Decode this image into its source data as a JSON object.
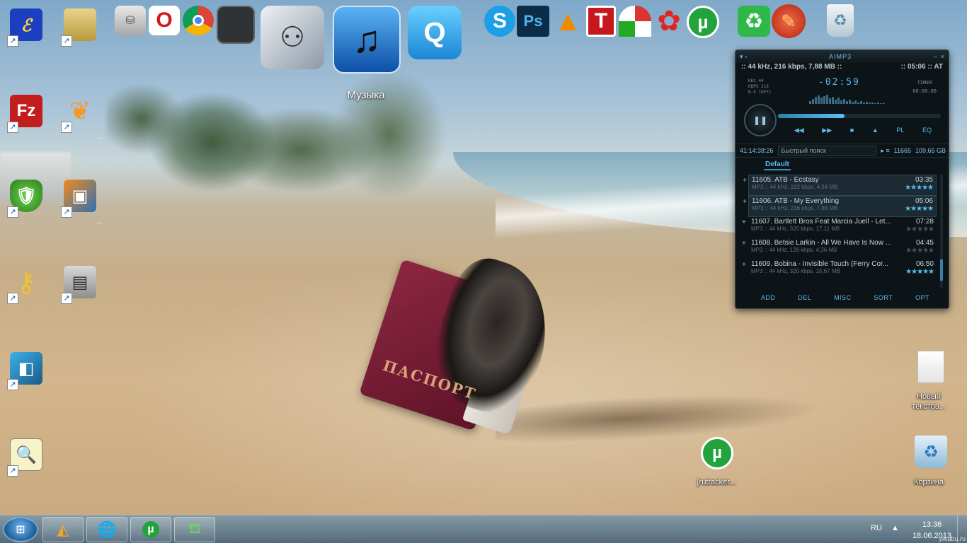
{
  "desktop": {
    "icons_left": [
      {
        "name": "app-e-icon",
        "label": ""
      },
      {
        "name": "folder-icon",
        "label": ""
      },
      {
        "name": "filezilla-icon",
        "label": ""
      },
      {
        "name": "butterfly-icon",
        "label": ""
      },
      {
        "name": "drweb-icon",
        "label": ""
      },
      {
        "name": "vmware-icon",
        "label": ""
      },
      {
        "name": "key-icon",
        "label": ""
      },
      {
        "name": "safe-icon",
        "label": ""
      },
      {
        "name": "squares-icon",
        "label": ""
      },
      {
        "name": "search-doc-icon",
        "label": ""
      }
    ],
    "icons_right": [
      {
        "name": "new-text-file-icon",
        "label": "Новый текстов..."
      },
      {
        "name": "recycle-bin-icon",
        "label": "Корзина"
      },
      {
        "name": "utorrent-file-icon",
        "label": "[rutracker..."
      }
    ],
    "dock": {
      "hover_label": "Музыка",
      "icons": [
        "drive-icon",
        "opera-icon",
        "chrome-icon",
        "dark-square-icon",
        "photo-icon",
        "itunes-music-icon",
        "quicktime-icon",
        "skype-icon",
        "photoshop-icon",
        "vlc-icon",
        "t-app-icon",
        "umbrella-icon",
        "flower-icon",
        "utorrent-icon",
        "recycle-green-icon",
        "ccleaner-icon",
        "trash-icon"
      ]
    }
  },
  "aimp": {
    "title": "AIMP3",
    "info_left": ":: 44 kHz, 216 kbps, 7,88 MB ::",
    "info_right": ":: 05:06 :: AT",
    "time": "-02:59",
    "stats_khz": "KHz   44",
    "stats_kbps": "KBPS 216",
    "stats_mode": "B-S [OFF]",
    "timer_label": "TIMER",
    "timer_value": "00:00:00",
    "controls": [
      "◀◀",
      "▶▶",
      "■",
      "▲",
      "PL",
      "EQ"
    ],
    "total_time": "41:14:38:26",
    "search_placeholder": "Быстрый поиск",
    "count": "11665",
    "size": "109,65 GB",
    "tab": "Default",
    "progress": 0.41,
    "tracks": [
      {
        "title": "11605. ATB - Ecstasy",
        "duration": "03:35",
        "meta": "MP3 :: 44 kHz, 192 kbps, 4,94 MB",
        "stars": "★★★★★",
        "rated": true,
        "selected": true
      },
      {
        "title": "11606. ATB - My Everything",
        "duration": "05:06",
        "meta": "MP3 :: 44 kHz, 216 kbps, 7,88 MB",
        "stars": "★★★★★",
        "rated": true,
        "selected": true
      },
      {
        "title": "11607. Bartlett Bros Feat Marcia Juell - Let...",
        "duration": "07:28",
        "meta": "MP3 :: 44 kHz, 320 kbps, 17,11 MB",
        "stars": "★★★★★",
        "rated": false,
        "selected": false
      },
      {
        "title": "11608. Betsie Larkin - All We Have Is Now ...",
        "duration": "04:45",
        "meta": "MP3 :: 44 kHz, 128 kbps, 4,36 MB",
        "stars": "★★★★★",
        "rated": false,
        "selected": false
      },
      {
        "title": "11609. Bobina - Invisible Touch (Ferry Cor...",
        "duration": "06:50",
        "meta": "MP3 :: 44 kHz, 320 kbps, 15,67 MB",
        "stars": "★★★★★",
        "rated": true,
        "selected": false
      }
    ],
    "bottom_buttons": [
      "ADD",
      "DEL",
      "MISC",
      "SORT",
      "OPT"
    ]
  },
  "passport_text": "ПАСПОРТ",
  "taskbar": {
    "language": "RU",
    "tray_arrow": "▲",
    "time": "13:36",
    "date": "18.06.2013",
    "watermark": "pikabu.ru"
  }
}
